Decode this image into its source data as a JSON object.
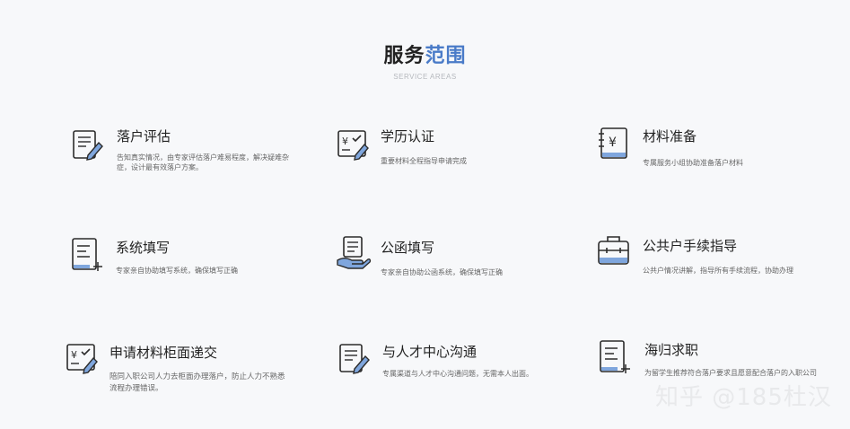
{
  "header": {
    "title_part1": "服务",
    "title_part2": "范围",
    "subtitle": "SERVICE AREAS"
  },
  "services": [
    {
      "title": "落户评估",
      "desc": "告知真实情况，由专家评估落户难易程度，解决疑难杂症，设计最有效落户方案。",
      "icon": "document-pencil-icon"
    },
    {
      "title": "学历认证",
      "desc": "重要材料全程指导申请完成",
      "icon": "yuan-check-pencil-icon"
    },
    {
      "title": "材料准备",
      "desc": "专属服务小组协助准备落户材料",
      "icon": "notebook-yuan-icon"
    },
    {
      "title": "系统填写",
      "desc": "专家亲自协助填写系统，确保填写正确",
      "icon": "form-plus-icon"
    },
    {
      "title": "公函填写",
      "desc": "专家亲自协助公函系统，确保填写正确",
      "icon": "hand-document-icon"
    },
    {
      "title": "公共户手续指导",
      "desc": "公共户情况讲解，指导所有手续流程，协助办理",
      "icon": "briefcase-icon"
    },
    {
      "title": "申请材料柜面递交",
      "desc": "陪同入职公司人力去柜面办理落户，防止人力不熟悉流程办理错误。",
      "icon": "yuan-check-pencil-icon"
    },
    {
      "title": "与人才中心沟通",
      "desc": "专属渠道与人才中心沟通问题，无需本人出面。",
      "icon": "document-pencil-icon"
    },
    {
      "title": "海归求职",
      "desc": "为留学生推荐符合落户要求且愿意配合落户的入职公司",
      "icon": "form-plus-icon"
    }
  ],
  "watermark": "知乎 @185杜汉",
  "colors": {
    "accent": "#4a7bc8",
    "icon_stroke": "#2b2b2b",
    "icon_fill": "#7fa6dd"
  }
}
